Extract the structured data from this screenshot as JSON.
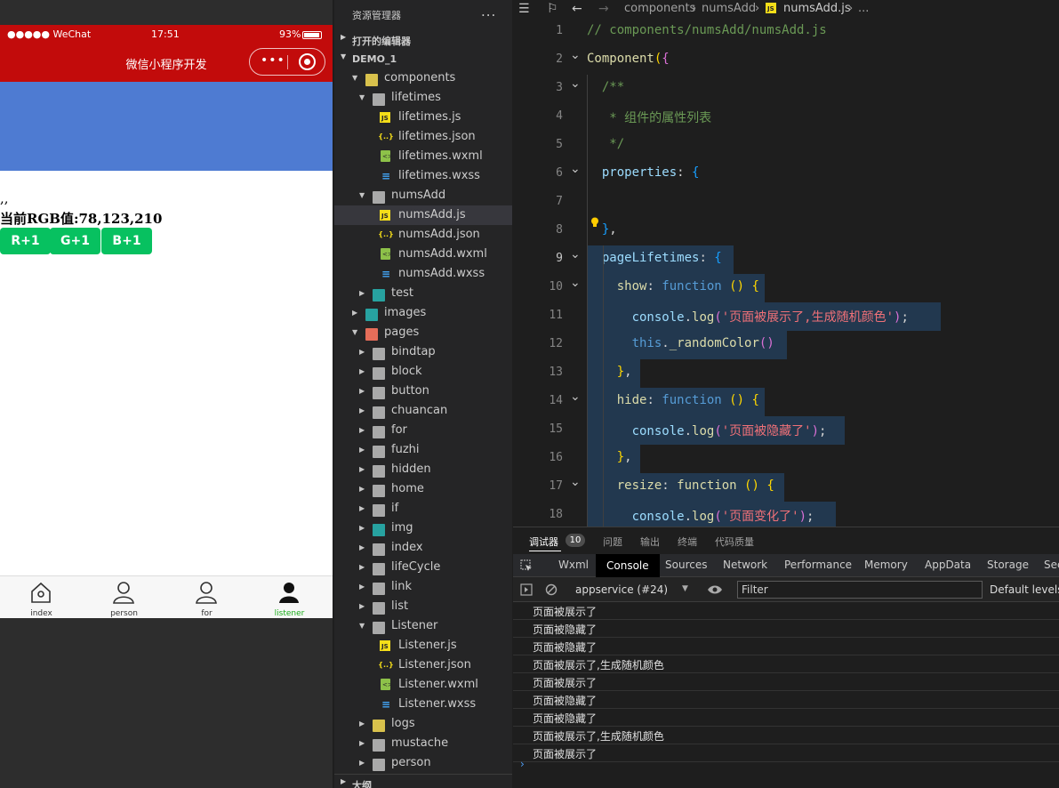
{
  "simulator": {
    "carrier": "●●●●● WeChat",
    "time": "17:51",
    "battery": "93%",
    "nav_title": "微信小程序开发",
    "capsule_more": "•••",
    "color_block_rgb": "#4e7bd2",
    "commas": ",,",
    "rgb_text": "当前RGB值:78,123,210",
    "buttons": [
      "R+1",
      "G+1",
      "B+1"
    ],
    "tabs": [
      {
        "label": "index",
        "icon": "home-icon",
        "active": false
      },
      {
        "label": "person",
        "icon": "person-icon",
        "active": false
      },
      {
        "label": "for",
        "icon": "person-icon",
        "active": false
      },
      {
        "label": "listener",
        "icon": "person-filled-icon",
        "active": true
      }
    ]
  },
  "explorer": {
    "title": "资源管理器",
    "more": "...",
    "open_editors": "打开的编辑器",
    "project": "DEMO_1",
    "outline": "大纲",
    "tree": [
      {
        "name": "components",
        "depth": 0,
        "kind": "folder-open",
        "color": "yellow"
      },
      {
        "name": "lifetimes",
        "depth": 1,
        "kind": "folder-open",
        "color": "plain"
      },
      {
        "name": "lifetimes.js",
        "depth": 2,
        "kind": "js"
      },
      {
        "name": "lifetimes.json",
        "depth": 2,
        "kind": "json"
      },
      {
        "name": "lifetimes.wxml",
        "depth": 2,
        "kind": "wxml"
      },
      {
        "name": "lifetimes.wxss",
        "depth": 2,
        "kind": "wxss"
      },
      {
        "name": "numsAdd",
        "depth": 1,
        "kind": "folder-open",
        "color": "plain"
      },
      {
        "name": "numsAdd.js",
        "depth": 2,
        "kind": "js",
        "selected": true
      },
      {
        "name": "numsAdd.json",
        "depth": 2,
        "kind": "json"
      },
      {
        "name": "numsAdd.wxml",
        "depth": 2,
        "kind": "wxml"
      },
      {
        "name": "numsAdd.wxss",
        "depth": 2,
        "kind": "wxss"
      },
      {
        "name": "test",
        "depth": 1,
        "kind": "folder",
        "color": "teal"
      },
      {
        "name": "images",
        "depth": 0,
        "kind": "folder",
        "color": "teal"
      },
      {
        "name": "pages",
        "depth": 0,
        "kind": "folder-open",
        "color": "red"
      },
      {
        "name": "bindtap",
        "depth": 1,
        "kind": "folder",
        "color": "plain"
      },
      {
        "name": "block",
        "depth": 1,
        "kind": "folder",
        "color": "plain"
      },
      {
        "name": "button",
        "depth": 1,
        "kind": "folder",
        "color": "plain"
      },
      {
        "name": "chuancan",
        "depth": 1,
        "kind": "folder",
        "color": "plain"
      },
      {
        "name": "for",
        "depth": 1,
        "kind": "folder",
        "color": "plain"
      },
      {
        "name": "fuzhi",
        "depth": 1,
        "kind": "folder",
        "color": "plain"
      },
      {
        "name": "hidden",
        "depth": 1,
        "kind": "folder",
        "color": "plain"
      },
      {
        "name": "home",
        "depth": 1,
        "kind": "folder",
        "color": "plain"
      },
      {
        "name": "if",
        "depth": 1,
        "kind": "folder",
        "color": "plain"
      },
      {
        "name": "img",
        "depth": 1,
        "kind": "folder",
        "color": "teal"
      },
      {
        "name": "index",
        "depth": 1,
        "kind": "folder",
        "color": "plain"
      },
      {
        "name": "lifeCycle",
        "depth": 1,
        "kind": "folder",
        "color": "plain"
      },
      {
        "name": "link",
        "depth": 1,
        "kind": "folder",
        "color": "plain"
      },
      {
        "name": "list",
        "depth": 1,
        "kind": "folder",
        "color": "plain"
      },
      {
        "name": "Listener",
        "depth": 1,
        "kind": "folder-open",
        "color": "plain"
      },
      {
        "name": "Listener.js",
        "depth": 2,
        "kind": "js"
      },
      {
        "name": "Listener.json",
        "depth": 2,
        "kind": "json"
      },
      {
        "name": "Listener.wxml",
        "depth": 2,
        "kind": "wxml"
      },
      {
        "name": "Listener.wxss",
        "depth": 2,
        "kind": "wxss"
      },
      {
        "name": "logs",
        "depth": 1,
        "kind": "folder",
        "color": "yellow"
      },
      {
        "name": "mustache",
        "depth": 1,
        "kind": "folder",
        "color": "plain"
      },
      {
        "name": "person",
        "depth": 1,
        "kind": "folder",
        "color": "plain"
      }
    ]
  },
  "editor": {
    "breadcrumb": [
      "components",
      "numsAdd",
      "numsAdd.js",
      "..."
    ],
    "lines": [
      {
        "n": "1",
        "fold": false,
        "code": [
          [
            "c-com",
            "// components/numsAdd/numsAdd.js"
          ]
        ]
      },
      {
        "n": "2",
        "fold": true,
        "code": [
          [
            "c-fn",
            "Component"
          ],
          [
            "c-br1",
            "("
          ],
          [
            "c-br2",
            "{"
          ]
        ]
      },
      {
        "n": "3",
        "fold": true,
        "code": [
          [
            "c-com",
            "  /**"
          ]
        ]
      },
      {
        "n": "4",
        "fold": false,
        "code": [
          [
            "c-com",
            "   * 组件的属性列表"
          ]
        ]
      },
      {
        "n": "5",
        "fold": false,
        "code": [
          [
            "c-com",
            "   */"
          ]
        ]
      },
      {
        "n": "6",
        "fold": true,
        "code": [
          [
            "c-prop",
            "  properties"
          ],
          [
            "c-pun",
            ": "
          ],
          [
            "c-br3",
            "{"
          ]
        ]
      },
      {
        "n": "7",
        "fold": false,
        "code": []
      },
      {
        "n": "8",
        "fold": false,
        "code": [
          [
            "c-br3",
            "  }"
          ],
          [
            "c-pun",
            ","
          ]
        ]
      },
      {
        "n": "9",
        "fold": true,
        "cur": true,
        "code": [
          [
            "c-prop",
            "  pageLifetimes"
          ],
          [
            "c-pun",
            ": "
          ],
          [
            "c-br3",
            "{"
          ]
        ]
      },
      {
        "n": "10",
        "fold": true,
        "code": [
          [
            "c-fn",
            "    show"
          ],
          [
            "c-pun",
            ": "
          ],
          [
            "c-kw",
            "function"
          ],
          [
            "c-pun",
            " "
          ],
          [
            "c-br1",
            "()"
          ],
          [
            "c-pun",
            " "
          ],
          [
            "c-br1",
            "{"
          ]
        ]
      },
      {
        "n": "11",
        "fold": false,
        "code": [
          [
            "c-prop",
            "      console"
          ],
          [
            "c-pun",
            "."
          ],
          [
            "c-fn",
            "log"
          ],
          [
            "c-br2",
            "("
          ],
          [
            "c-str2",
            "'页面被展示了,生成随机颜色'"
          ],
          [
            "c-br2",
            ")"
          ],
          [
            "c-pun",
            ";"
          ]
        ]
      },
      {
        "n": "12",
        "fold": false,
        "code": [
          [
            "c-kw",
            "      this"
          ],
          [
            "c-pun",
            "."
          ],
          [
            "c-fn",
            "_randomColor"
          ],
          [
            "c-br2",
            "()"
          ]
        ]
      },
      {
        "n": "13",
        "fold": false,
        "code": [
          [
            "c-br1",
            "    }"
          ],
          [
            "c-pun",
            ","
          ]
        ]
      },
      {
        "n": "14",
        "fold": true,
        "code": [
          [
            "c-fn",
            "    hide"
          ],
          [
            "c-pun",
            ": "
          ],
          [
            "c-kw",
            "function"
          ],
          [
            "c-pun",
            " "
          ],
          [
            "c-br1",
            "()"
          ],
          [
            "c-pun",
            " "
          ],
          [
            "c-br1",
            "{"
          ]
        ]
      },
      {
        "n": "15",
        "fold": false,
        "code": [
          [
            "c-prop",
            "      console"
          ],
          [
            "c-pun",
            "."
          ],
          [
            "c-fn",
            "log"
          ],
          [
            "c-br2",
            "("
          ],
          [
            "c-str2",
            "'页面被隐藏了'"
          ],
          [
            "c-br2",
            ")"
          ],
          [
            "c-pun",
            ";"
          ]
        ]
      },
      {
        "n": "16",
        "fold": false,
        "code": [
          [
            "c-br1",
            "    }"
          ],
          [
            "c-pun",
            ","
          ]
        ]
      },
      {
        "n": "17",
        "fold": true,
        "code": [
          [
            "c-fn",
            "    resize"
          ],
          [
            "c-pun",
            ": "
          ],
          [
            "c-fn",
            "function"
          ],
          [
            "c-pun",
            " "
          ],
          [
            "c-br1",
            "()"
          ],
          [
            "c-pun",
            " "
          ],
          [
            "c-br1",
            "{"
          ]
        ]
      },
      {
        "n": "18",
        "fold": false,
        "code": [
          [
            "c-prop",
            "      console"
          ],
          [
            "c-pun",
            "."
          ],
          [
            "c-fn",
            "log"
          ],
          [
            "c-br2",
            "("
          ],
          [
            "c-str2",
            "'页面变化了'"
          ],
          [
            "c-br2",
            ")"
          ],
          [
            "c-pun",
            ";"
          ]
        ]
      }
    ]
  },
  "debug": {
    "tabs": [
      "调试器",
      "问题",
      "输出",
      "终端",
      "代码质量"
    ],
    "badge": "10",
    "devtools_tabs": [
      "Wxml",
      "Console",
      "Sources",
      "Network",
      "Performance",
      "Memory",
      "AppData",
      "Storage",
      "Sec"
    ],
    "active_devtool": "Console",
    "context": "appservice (#24)",
    "filter_placeholder": "Filter",
    "levels": "Default levels",
    "logs": [
      "页面被展示了",
      "页面被隐藏了",
      "页面被隐藏了",
      "页面被展示了,生成随机颜色",
      "页面被展示了",
      "页面被隐藏了",
      "页面被隐藏了",
      "页面被展示了,生成随机颜色",
      "页面被展示了"
    ],
    "prompt": "›"
  }
}
